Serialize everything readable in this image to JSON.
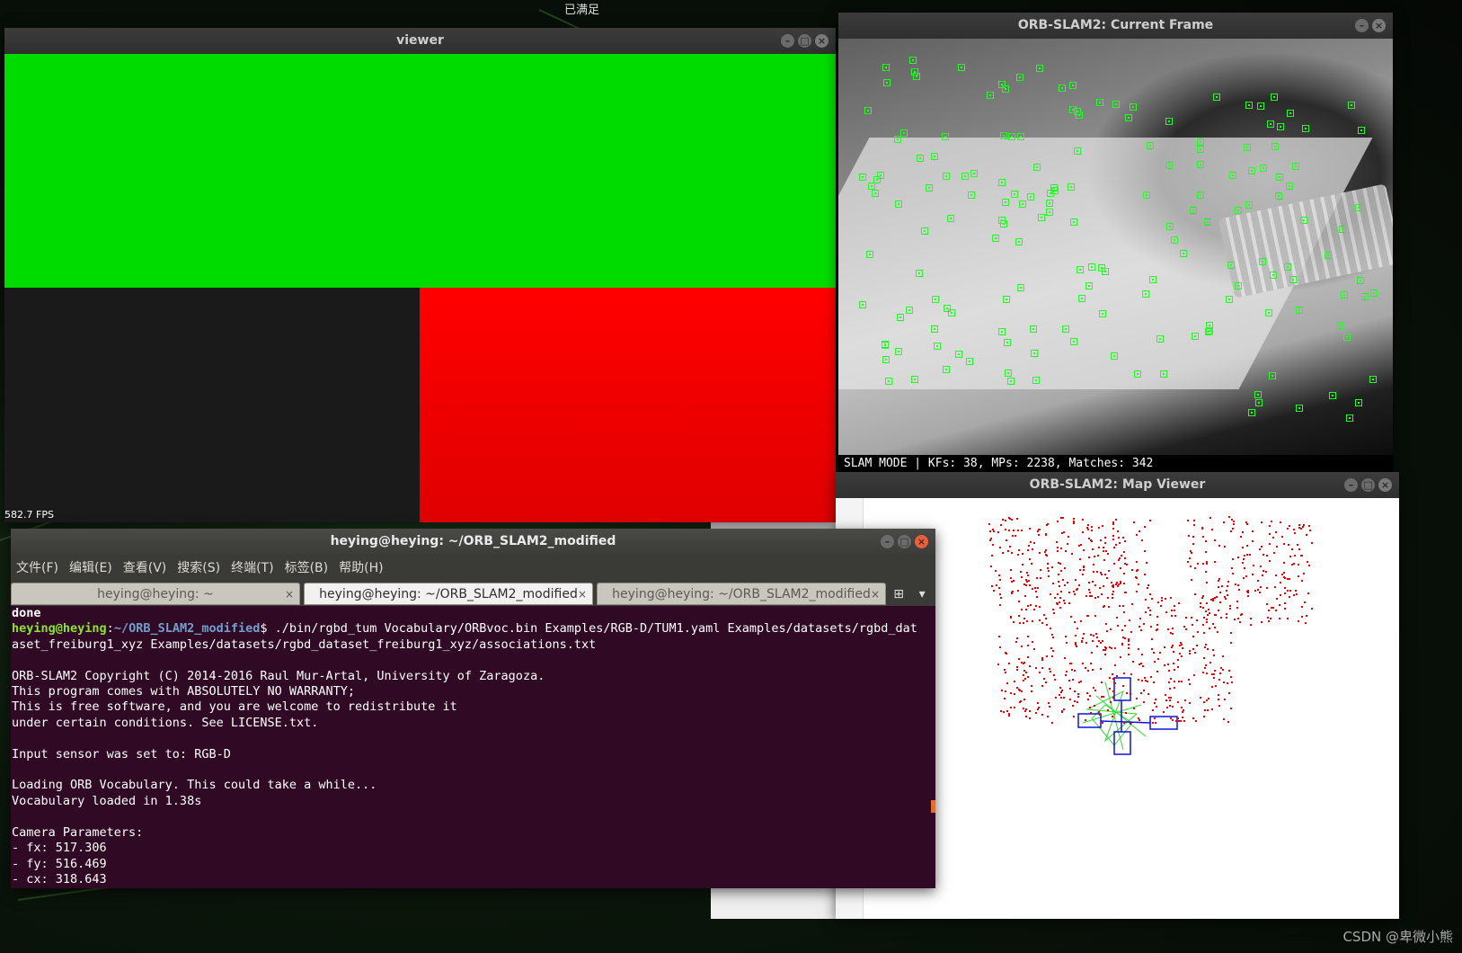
{
  "desktop": {
    "top_label": "已满足",
    "watermark": "CSDN @卑微小熊"
  },
  "viewer": {
    "title": "viewer",
    "fps": "582.7 FPS"
  },
  "current_frame": {
    "title": "ORB-SLAM2: Current Frame",
    "status": "SLAM MODE |  KFs: 38, MPs: 2238, Matches: 342"
  },
  "map_viewer": {
    "title": "ORB-SLAM2: Map Viewer"
  },
  "terminal": {
    "title": "heying@heying: ~/ORB_SLAM2_modified",
    "menu": [
      "文件(F)",
      "编辑(E)",
      "查看(V)",
      "搜索(S)",
      "终端(T)",
      "标签(B)",
      "帮助(H)"
    ],
    "tabs": [
      {
        "label": "heying@heying: ~",
        "active": false
      },
      {
        "label": "heying@heying: ~/ORB_SLAM2_modified",
        "active": true
      },
      {
        "label": "heying@heying: ~/ORB_SLAM2_modified",
        "active": false
      }
    ],
    "lines": {
      "done": "done",
      "prompt_user": "heying@heying",
      "prompt_sep": ":",
      "prompt_path": "~/ORB_SLAM2_modified",
      "command": "$ ./bin/rgbd_tum Vocabulary/ORBvoc.bin Examples/RGB-D/TUM1.yaml Examples/datasets/rgbd_dataset_freiburg1_xyz Examples/datasets/rgbd_dataset_freiburg1_xyz/associations.txt",
      "body": "\nORB-SLAM2 Copyright (C) 2014-2016 Raul Mur-Artal, University of Zaragoza.\nThis program comes with ABSOLUTELY NO WARRANTY;\nThis is free software, and you are welcome to redistribute it\nunder certain conditions. See LICENSE.txt.\n\nInput sensor was set to: RGB-D\n\nLoading ORB Vocabulary. This could take a while...\nVocabulary loaded in 1.38s\n\nCamera Parameters:\n- fx: 517.306\n- fy: 516.469\n- cx: 318.643"
    }
  }
}
